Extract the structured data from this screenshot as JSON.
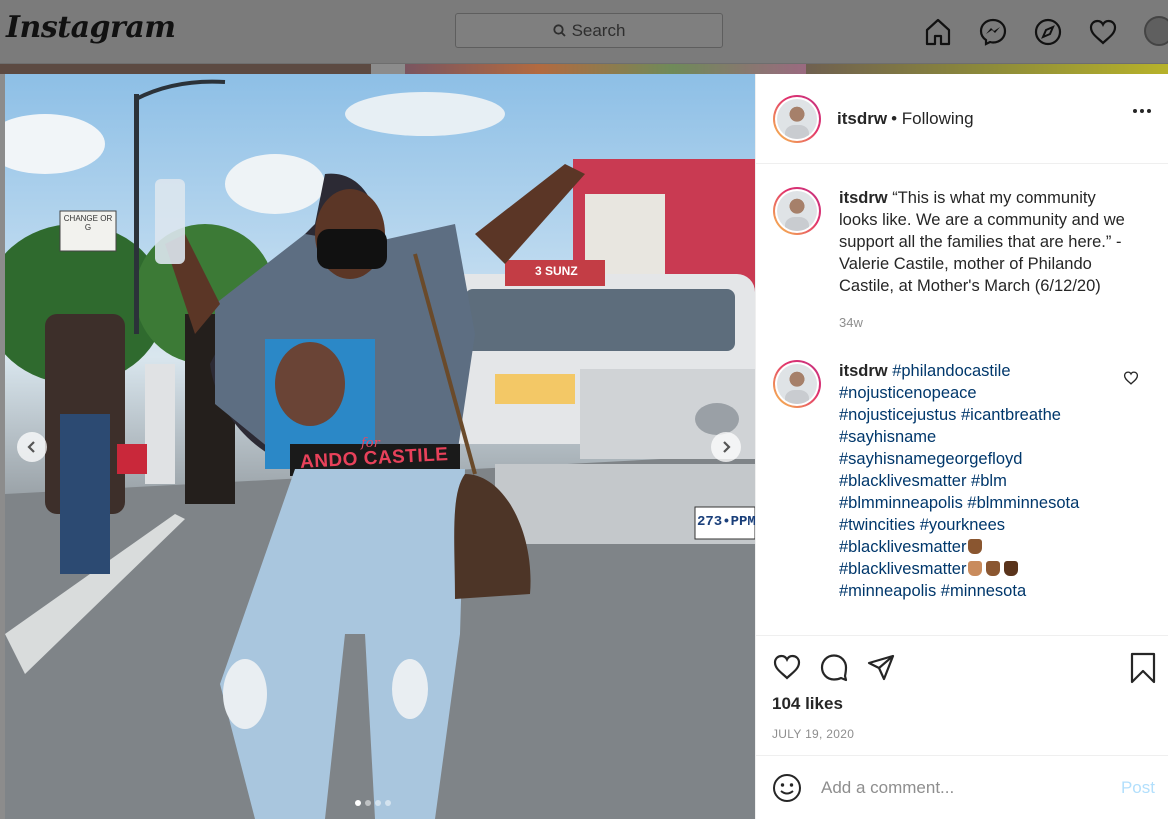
{
  "nav": {
    "logo": "Instagram",
    "search_placeholder": "Search",
    "icons": [
      "home-icon",
      "messenger-icon",
      "explore-icon",
      "heart-icon",
      "profile-avatar"
    ]
  },
  "post": {
    "username": "itsdrw",
    "follow_status": "• Following",
    "caption": {
      "username": "itsdrw",
      "text": "“This is what my community looks like. We are a community and we support all the families that are here.” - Valerie Castile, mother of Philando Castile, at Mother's March (6/12/20)",
      "age": "34w"
    },
    "hashtag_comment": {
      "username": "itsdrw",
      "lines": [
        "#philandocastile",
        "#nojusticenopeace",
        "#nojusticejustus #icantbreathe",
        "#sayhisname",
        "#sayhisnamegeorgefloyd",
        "#blacklivesmatter #blm",
        "#blmminneapolis #blmminnesota",
        "#twincities #yourknees",
        "#blacklivesmatter",
        "#blacklivesmatter",
        "#minneapolis #minnesota"
      ]
    },
    "likes": "104 likes",
    "date": "JULY 19, 2020",
    "comment_placeholder": "Add a comment...",
    "post_button": "Post",
    "photo_text": {
      "sign": "CHANGE OR G",
      "plate": "273•PPM",
      "shirt": "ANDO CASTILE",
      "shirt_for": "for",
      "truck_label": "3 SUNZ"
    },
    "carousel": {
      "total": 4,
      "current": 1
    }
  },
  "colors": {
    "link": "#00376b",
    "post_button": "#b2dffc",
    "muted": "#8e8e8e",
    "story_ring_start": "#f9c94e",
    "story_ring_end": "#c13584"
  }
}
